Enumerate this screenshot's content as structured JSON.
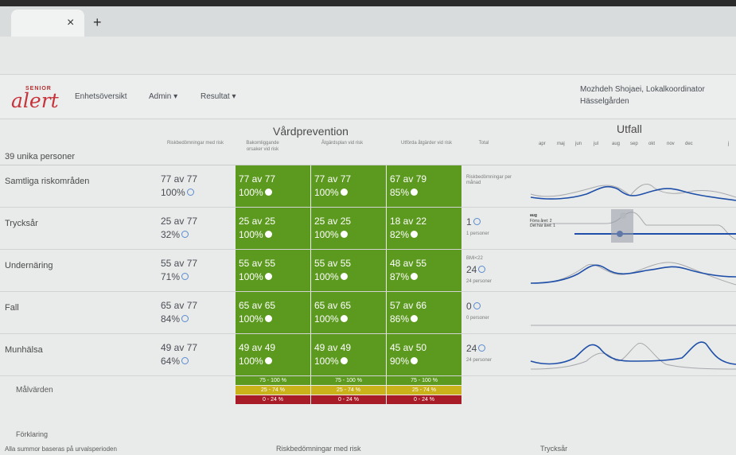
{
  "browser": {
    "tab_close": "×",
    "tab_new": "+"
  },
  "nav": {
    "logo_top": "SENIOR",
    "logo_main": "alert",
    "links": [
      "Enhetsöversikt",
      "Admin ▾",
      "Resultat ▾"
    ],
    "user_name": "Mozhdeh Shojaei, Lokalkoordinator",
    "user_unit": "Hässelgården"
  },
  "headers": {
    "prevention_title": "Vårdprevention",
    "outcome_title": "Utfall",
    "unique_persons": "39 unika personer",
    "col_risk": "Riskbedömningar med risk",
    "col_causes": "Bakomliggande orsaker vid risk",
    "col_plan": "Åtgärdsplan vid risk",
    "col_done": "Utförda åtgärder vid risk",
    "col_total": "Total",
    "months": [
      "apr",
      "maj",
      "jun",
      "jul",
      "aug",
      "sep",
      "okt",
      "nov",
      "dec",
      "j"
    ]
  },
  "rows": [
    {
      "label": "Samtliga riskområden",
      "risk_count": "77 av 77",
      "risk_pct": "100%",
      "causes_count": "77 av 77",
      "causes_pct": "100%",
      "plan_count": "77 av 77",
      "plan_pct": "100%",
      "done_count": "67 av 79",
      "done_pct": "85%",
      "total_big": "",
      "total_small": "Riskbedömningar per månad"
    },
    {
      "label": "Trycksår",
      "risk_count": "25 av 77",
      "risk_pct": "32%",
      "causes_count": "25 av 25",
      "causes_pct": "100%",
      "plan_count": "25 av 25",
      "plan_pct": "100%",
      "done_count": "18 av 22",
      "done_pct": "82%",
      "total_big": "1",
      "total_small": "1 personer"
    },
    {
      "label": "Undernäring",
      "risk_count": "55 av 77",
      "risk_pct": "71%",
      "causes_count": "55 av 55",
      "causes_pct": "100%",
      "plan_count": "55 av 55",
      "plan_pct": "100%",
      "done_count": "48 av 55",
      "done_pct": "87%",
      "total_big": "24",
      "total_small": "24 personer",
      "total_pre": "BMI<22"
    },
    {
      "label": "Fall",
      "risk_count": "65 av 77",
      "risk_pct": "84%",
      "causes_count": "65 av 65",
      "causes_pct": "100%",
      "plan_count": "65 av 65",
      "plan_pct": "100%",
      "done_count": "57 av 66",
      "done_pct": "86%",
      "total_big": "0",
      "total_small": "0 personer"
    },
    {
      "label": "Munhälsa",
      "risk_count": "49 av 77",
      "risk_pct": "64%",
      "causes_count": "49 av 49",
      "causes_pct": "100%",
      "plan_count": "49 av 49",
      "plan_pct": "100%",
      "done_count": "45 av 50",
      "done_pct": "90%",
      "total_big": "24",
      "total_small": "24 personer"
    }
  ],
  "tooltip": {
    "month": "aug",
    "prev_year": "Förra året: 2",
    "this_year": "Det här året: 1"
  },
  "legend": {
    "label": "Målvärden",
    "green": "75 - 100 %",
    "yellow": "25 - 74 %",
    "red": "0 - 24 %"
  },
  "footer": {
    "explanation": "Förklaring",
    "note": "Alla summor baseras på urvalsperioden",
    "risk_title": "Riskbedömningar med risk",
    "pressure_title": "Trycksår"
  },
  "colors": {
    "green": "#5c9a1f",
    "yellow": "#c9b21a",
    "red": "#a81c28",
    "line_blue": "#1f4fa8",
    "line_grey": "#a6a8ad"
  }
}
